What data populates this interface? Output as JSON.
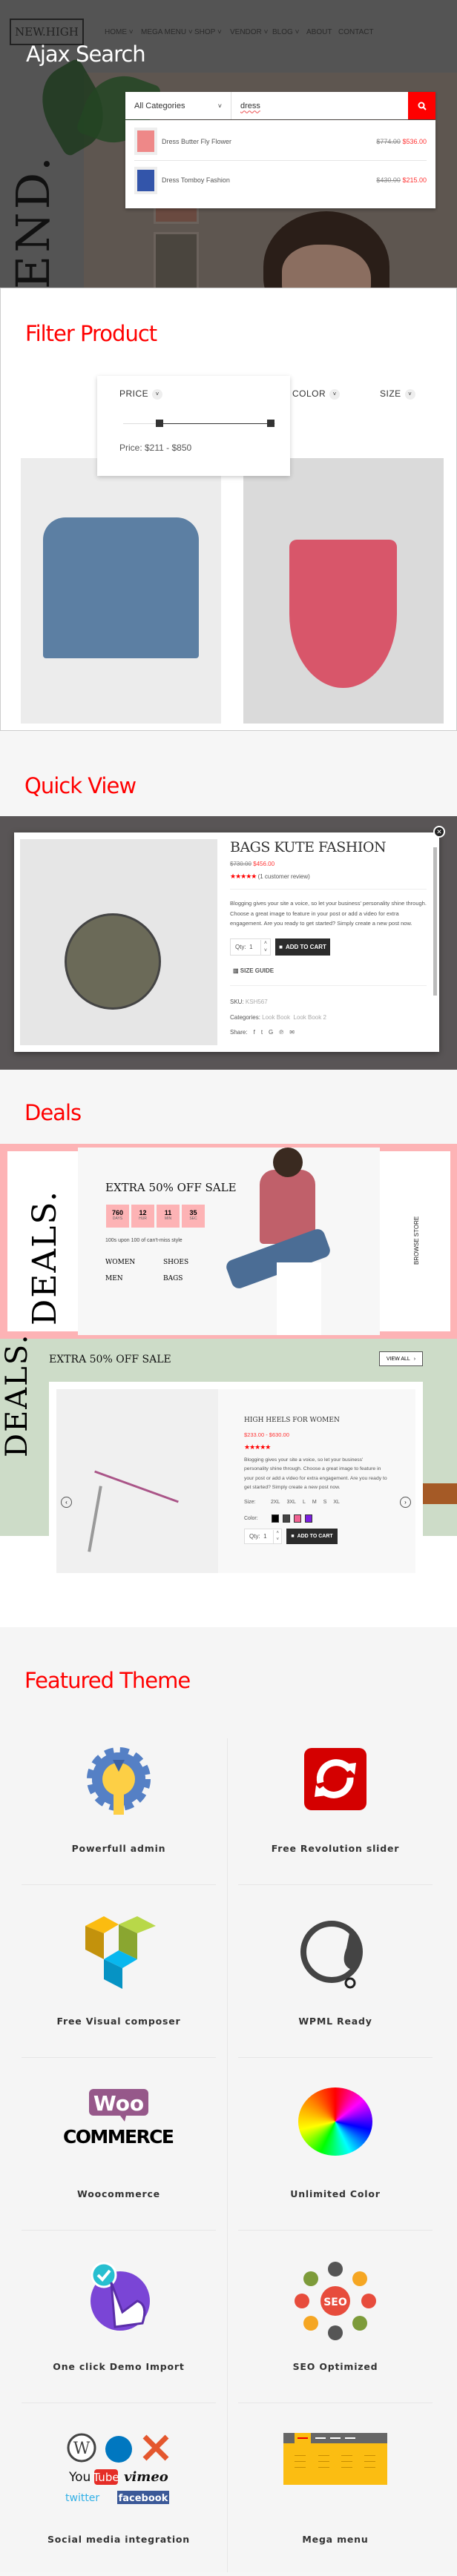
{
  "hero": {
    "section_title": "Ajax Search",
    "logo": "NEW.HIGH",
    "nav": [
      "HOME",
      "MEGA MENU",
      "SHOP",
      "VENDOR",
      "BLOG",
      "ABOUT",
      "CONTACT"
    ],
    "nav_has_dropdown": [
      true,
      true,
      true,
      true,
      true,
      false,
      false
    ],
    "background_text": "END.",
    "search": {
      "category": "All Categories",
      "query": "dress",
      "button_icon": "search-icon",
      "button_color": "#ff0000",
      "results": [
        {
          "name": "Dress Butter Fly Flower",
          "old_price": "$774.00",
          "price": "$536.00"
        },
        {
          "name": "Dress Tomboy Fashion",
          "old_price": "$430.00",
          "price": "$215.00"
        }
      ]
    }
  },
  "filter": {
    "section_title": "Filter Product",
    "filters": [
      "PRICE",
      "COLOR",
      "SIZE"
    ],
    "price_label": "Price: $211 - $850",
    "price_min": 211,
    "price_max": 850
  },
  "quickview": {
    "section_title": "Quick View",
    "title": "BAGS KUTE FASHION",
    "old_price": "$730.00",
    "price": "$456.00",
    "rating": 5,
    "stars": "★★★★★",
    "review": "(1 customer review)",
    "description": "Blogging gives your site a voice, so let your business' personality shine through. Choose a great image to feature in your post or add a video for extra engagement. Are you ready to get started? Simply create a new post now.",
    "qty_label": "Qty:",
    "qty": "1",
    "add_to_cart": "ADD TO CART",
    "size_guide": "SIZE GUIDE",
    "sku_label": "SKU:",
    "sku": "KSH567",
    "categories_label": "Categories:",
    "categories": [
      "Look Book",
      "Look Book 2"
    ],
    "share_label": "Share:",
    "share_icons": [
      "facebook-icon",
      "twitter-icon",
      "google-icon",
      "pinterest-icon",
      "email-icon"
    ]
  },
  "deals": {
    "section_title": "Deals",
    "banner1": {
      "vertical": "DEALS.",
      "title": "EXTRA 50% OFF SALE",
      "countdown": [
        {
          "value": "760",
          "unit": "DAYS"
        },
        {
          "value": "12",
          "unit": "HUR"
        },
        {
          "value": "11",
          "unit": "MIN"
        },
        {
          "value": "35",
          "unit": "SEC"
        }
      ],
      "tagline": "100s upon 100 of can't-miss style",
      "links": [
        "WOMEN",
        "SHOES",
        "MEN",
        "BAGS"
      ],
      "browse": "BROWSE STORE",
      "color": "#fdb3b5"
    },
    "banner2": {
      "vertical": "DEALS.",
      "title": "EXTRA 50% OFF SALE",
      "view_all": "VIEW ALL",
      "color": "#cddcc8",
      "product": {
        "title": "HIGH HEELS FOR WOMEN",
        "price": "$233.00 - $630.00",
        "stars": "★★★★★",
        "description": "Blogging gives your site a voice, so let your business' personality shine through. Choose a great image to feature in your post or add a video for extra engagement. Are you ready to get started? Simply create a new post now.",
        "size_label": "Size:",
        "sizes": [
          "2XL",
          "3XL",
          "L",
          "M",
          "S",
          "XL"
        ],
        "color_label": "Color:",
        "colors": [
          "#000000",
          "#444444",
          "#f06292",
          "#7b1fe0"
        ],
        "qty_label": "Qty:",
        "qty": "1",
        "add_to_cart": "ADD TO CART"
      }
    }
  },
  "featured": {
    "section_title": "Featured Theme",
    "items": [
      {
        "label": "Powerfull admin",
        "icon": "gear-wrench-icon"
      },
      {
        "label": "Free Revolution slider",
        "icon": "refresh-icon"
      },
      {
        "label": "Free Visual composer",
        "icon": "visual-composer-icon"
      },
      {
        "label": "WPML Ready",
        "icon": "wpml-icon"
      },
      {
        "label": "Woocommerce",
        "icon": "woocommerce-icon",
        "logo_text": "WOO COMMERCE"
      },
      {
        "label": "Unlimited Color",
        "icon": "color-wheel-icon"
      },
      {
        "label": "One click Demo Import",
        "icon": "click-hand-icon"
      },
      {
        "label": "SEO Optimized",
        "icon": "seo-icon",
        "logo_text": "SEO"
      },
      {
        "label": "Social media integration",
        "icon": "social-logos-icon",
        "logo_text": "You Tube vimeo twitter facebook"
      },
      {
        "label": "Mega menu",
        "icon": "mega-menu-icon"
      }
    ]
  }
}
